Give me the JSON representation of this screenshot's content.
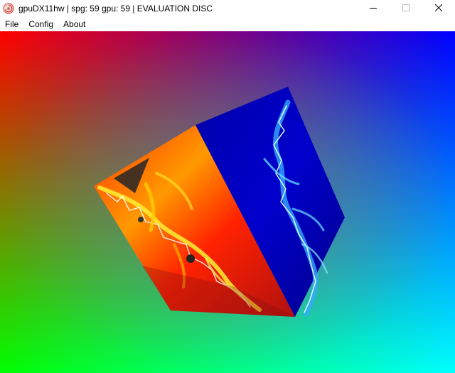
{
  "window": {
    "title": "gpuDX11hw | spg: 59 gpu: 59 | EVALUATION DISC",
    "icon": "emulator-disc-icon"
  },
  "window_controls": {
    "minimize_icon": "minimize-icon",
    "maximize_icon": "maximize-icon",
    "close_icon": "close-icon"
  },
  "menu": {
    "items": [
      {
        "label": "File"
      },
      {
        "label": "Config"
      },
      {
        "label": "About"
      }
    ]
  },
  "viewport": {
    "background_gradient": [
      "#ff0000",
      "#0000ff",
      "#00ff00",
      "#00ffff"
    ],
    "cube": {
      "left_face_colors": [
        "#ff0000",
        "#ff9900",
        "#ffff00"
      ],
      "right_face_colors": [
        "#000066",
        "#0000cc",
        "#66ddff"
      ]
    }
  }
}
